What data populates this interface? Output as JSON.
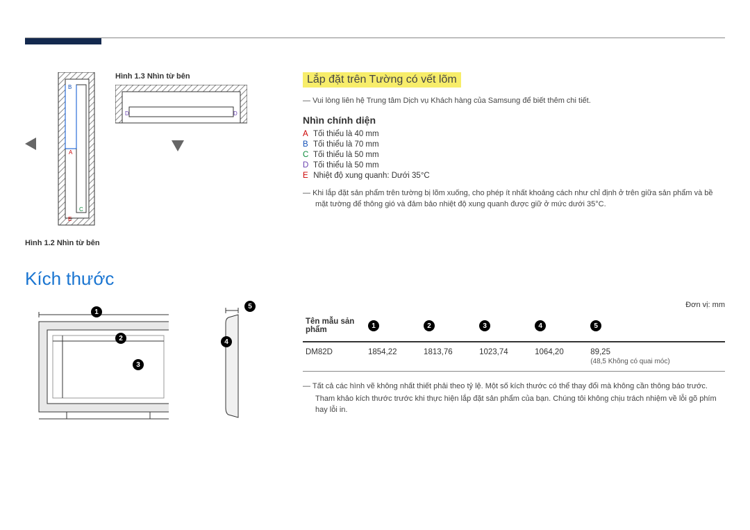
{
  "figures": {
    "fig13_caption": "Hình 1.3 Nhìn từ bên",
    "fig12_caption": "Hình 1.2 Nhìn từ bên",
    "labels": {
      "A": "A",
      "B": "B",
      "C": "C",
      "D": "D",
      "E": "E"
    }
  },
  "section": {
    "title": "Lắp đặt trên Tường có vết lõm",
    "note1": "Vui lòng liên hệ Trung tâm Dịch vụ Khách hàng của Samsung để biết thêm chi tiết.",
    "subhead": "Nhìn chính diện",
    "spec_a": "Tối thiểu là 40 mm",
    "spec_b": "Tối thiểu là 70 mm",
    "spec_c": "Tối thiểu là 50 mm",
    "spec_d": "Tối thiểu là 50 mm",
    "spec_e": "Nhiệt độ xung quanh: Dưới 35°C",
    "note2": "Khi lắp đặt sản phẩm trên tường bị lõm xuống, cho phép ít nhất khoảng cách như chỉ định ở trên giữa sản phẩm và bề mặt tường để thông gió và đảm bảo nhiệt độ xung quanh được giữ ở mức dưới 35°C."
  },
  "dimensions": {
    "heading": "Kích thước",
    "unit": "Đơn vị: mm",
    "table": {
      "header_model": "Tên mẫu sản phẩm",
      "cols": [
        "1",
        "2",
        "3",
        "4",
        "5"
      ],
      "row": {
        "model": "DM82D",
        "c1": "1854,22",
        "c2": "1813,76",
        "c3": "1023,74",
        "c4": "1064,20",
        "c5a": "89,25",
        "c5b": "(48,5 Không có quai móc)"
      }
    },
    "foot1": "Tất cả các hình vẽ không nhất thiết phải theo tỷ lệ. Một số kích thước có thể thay đổi mà không cần thông báo trước.",
    "foot2": "Tham khảo kích thước trước khi thực hiện lắp đặt sản phẩm của bạn. Chúng tôi không chịu trách nhiệm về lỗi gõ phím hay lỗi in."
  }
}
